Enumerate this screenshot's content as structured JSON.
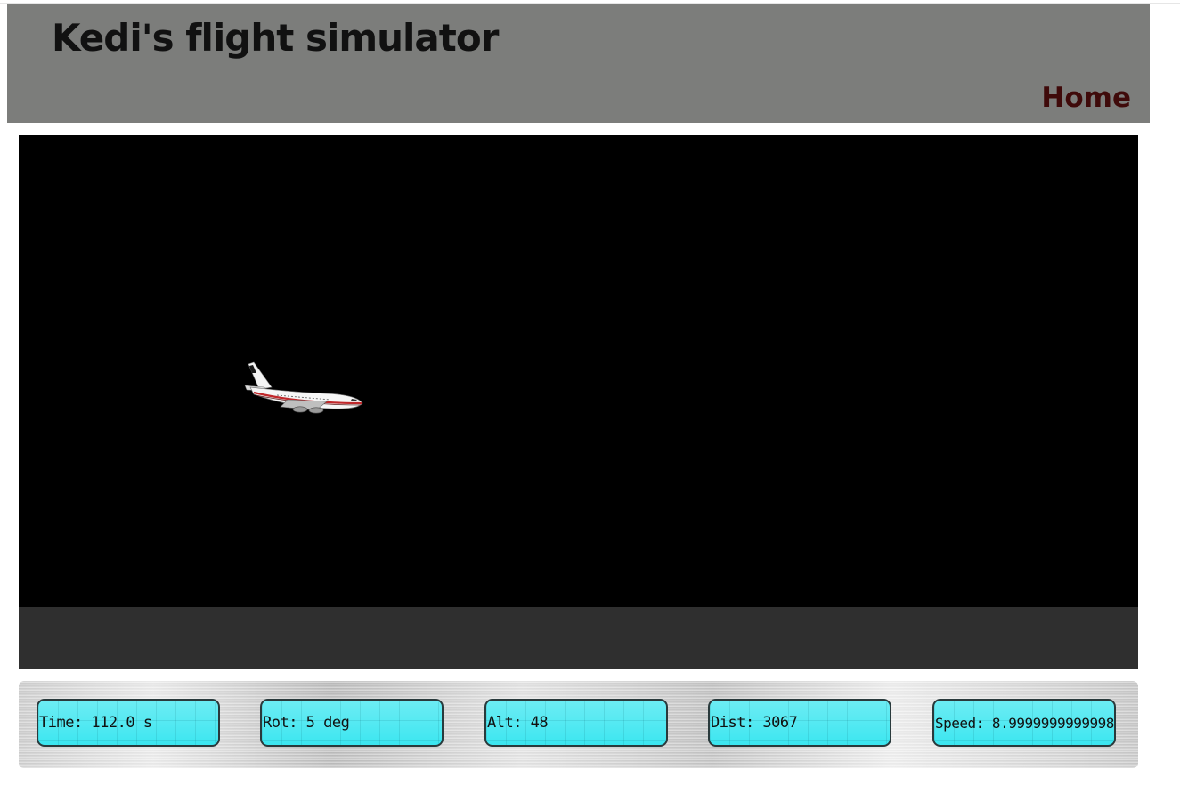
{
  "header": {
    "title": "Kedi's flight simulator",
    "nav_home": "Home"
  },
  "colors": {
    "header_bg": "#7c7d7b",
    "home_link": "#3f0a0a",
    "gauge_bg": "#3ce6f0",
    "viewport_bg": "#000000",
    "ground": "#2f2f2f"
  },
  "scene": {
    "aircraft": "airliner-icon"
  },
  "instruments": {
    "time": "Time: 112.0 s",
    "rot": "Rot: 5 deg",
    "alt": "Alt: 48",
    "dist": "Dist: 3067",
    "speed": "Speed: 8.9999999999998"
  }
}
